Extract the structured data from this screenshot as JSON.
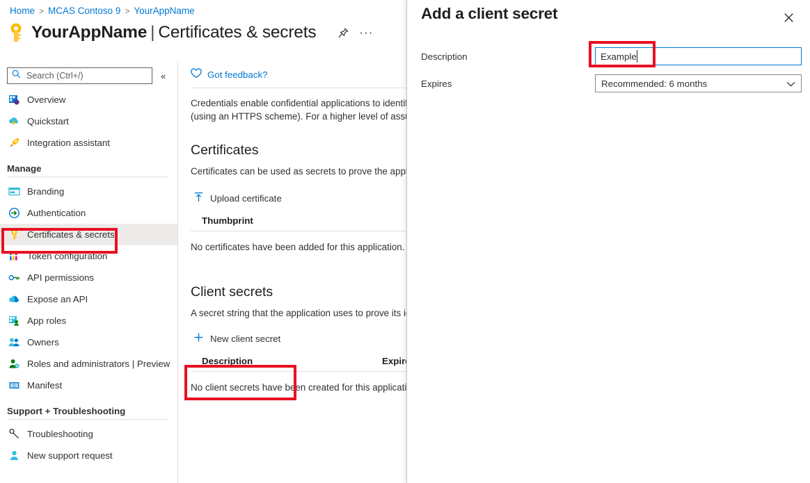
{
  "breadcrumb": {
    "items": [
      {
        "label": "Home",
        "link": true
      },
      {
        "label": "MCAS Contoso 9",
        "link": true
      },
      {
        "label": "YourAppName",
        "link": true
      }
    ],
    "separator": ">"
  },
  "header": {
    "app_name": "YourAppName",
    "separator": "|",
    "page_section": "Certificates & secrets",
    "key_icon": "key-icon",
    "pin_icon": "pin-icon",
    "more_label": "···"
  },
  "search": {
    "placeholder": "Search (Ctrl+/)",
    "value": "",
    "icon": "search-icon",
    "collapse_label": "«"
  },
  "sidebar": {
    "items": [
      {
        "label": "Overview",
        "icon": "grid-overview-icon",
        "type": "item",
        "selected": false
      },
      {
        "label": "Quickstart",
        "icon": "cloud-lightning-icon",
        "type": "item",
        "selected": false
      },
      {
        "label": "Integration assistant",
        "icon": "rocket-icon",
        "type": "item",
        "selected": false
      },
      {
        "label": "Manage",
        "type": "group"
      },
      {
        "label": "Branding",
        "icon": "branding-window-icon",
        "type": "item",
        "selected": false
      },
      {
        "label": "Authentication",
        "icon": "authentication-arrow-icon",
        "type": "item",
        "selected": false
      },
      {
        "label": "Certificates & secrets",
        "icon": "key-icon",
        "type": "item",
        "selected": true
      },
      {
        "label": "Token configuration",
        "icon": "token-bars-icon",
        "type": "item",
        "selected": false
      },
      {
        "label": "API permissions",
        "icon": "api-key-icon",
        "type": "item",
        "selected": false
      },
      {
        "label": "Expose an API",
        "icon": "cloud-icon",
        "type": "item",
        "selected": false
      },
      {
        "label": "App roles",
        "icon": "app-roles-icon",
        "type": "item",
        "selected": false
      },
      {
        "label": "Owners",
        "icon": "owners-people-icon",
        "type": "item",
        "selected": false
      },
      {
        "label": "Roles and administrators | Preview",
        "icon": "roles-person-icon",
        "type": "item",
        "selected": false
      },
      {
        "label": "Manifest",
        "icon": "manifest-icon",
        "type": "item",
        "selected": false
      },
      {
        "label": "Support + Troubleshooting",
        "type": "group"
      },
      {
        "label": "Troubleshooting",
        "icon": "wrench-icon",
        "type": "item",
        "selected": false
      },
      {
        "label": "New support request",
        "icon": "support-person-icon",
        "type": "item",
        "selected": false
      }
    ]
  },
  "main": {
    "feedback": {
      "label": "Got feedback?",
      "icon": "heart-icon"
    },
    "intro_line1": "Credentials enable confidential applications to identify",
    "intro_line2": "(using an HTTPS scheme). For a higher level of assuran",
    "certificates": {
      "heading": "Certificates",
      "description": "Certificates can be used as secrets to prove the applica",
      "upload_button": "Upload certificate",
      "upload_icon": "upload-arrow-icon",
      "column_thumbprint": "Thumbprint",
      "empty_message": "No certificates have been added for this application."
    },
    "client_secrets": {
      "heading": "Client secrets",
      "description": "A secret string that the application uses to prove its id",
      "new_button": "New client secret",
      "new_icon": "plus-icon",
      "column_description": "Description",
      "column_expires": "Expires",
      "empty_message": "No client secrets have been created for this application"
    }
  },
  "panel": {
    "title": "Add a client secret",
    "close_icon": "close-icon",
    "fields": {
      "description_label": "Description",
      "description_value": "Example",
      "expires_label": "Expires",
      "expires_value": "Recommended: 6 months",
      "expires_chevron": "chevron-down-icon"
    }
  },
  "annotations": {
    "color": "#e81123",
    "boxes": [
      {
        "name": "sidebar-certificates-highlight"
      },
      {
        "name": "new-client-secret-highlight"
      },
      {
        "name": "description-input-highlight"
      }
    ]
  }
}
